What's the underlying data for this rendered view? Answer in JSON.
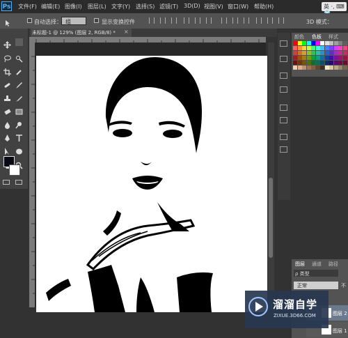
{
  "app": {
    "logo": "Ps"
  },
  "menu": [
    "文件(F)",
    "编辑(E)",
    "图像(I)",
    "图层(L)",
    "文字(Y)",
    "选择(S)",
    "滤镜(T)",
    "3D(D)",
    "视图(V)",
    "窗口(W)",
    "帮助(H)"
  ],
  "ime": {
    "label": "英 ·, ⌨ 👕"
  },
  "options": {
    "auto_select": "自动选择：",
    "auto_select_value": "组",
    "show_transform": "显示变换控件",
    "mode_3d": "3D 模式："
  },
  "document": {
    "tab": "未标题-1 @ 129% (图层 2, RGB/8) *",
    "close": "×"
  },
  "color_panel": {
    "tabs": [
      "颜色",
      "色板",
      "样式"
    ]
  },
  "layers_panel": {
    "tabs": [
      "图层",
      "通道",
      "路径"
    ],
    "filter": "ρ 类型",
    "mode": "正常",
    "opacity_label": "不",
    "rows": [
      "图层 2",
      "图层 1"
    ]
  },
  "watermark": {
    "title": "溜溜自学",
    "subtitle": "ZIXUE.3D66.COM"
  },
  "colors": {
    "accent": "#4fb1f5",
    "fg": "#0a0a14",
    "bg": "#ffffff"
  }
}
